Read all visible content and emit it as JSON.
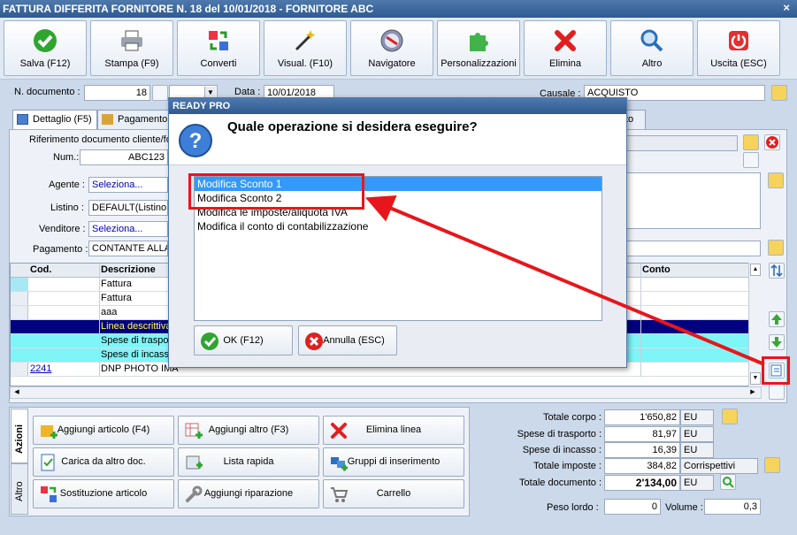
{
  "window": {
    "title": "FATTURA DIFFERITA FORNITORE N. 18 del 10/01/2018 - FORNITORE ABC",
    "close": "×"
  },
  "toolbar": [
    {
      "label": "Salva (F12)",
      "icon": "check-icon"
    },
    {
      "label": "Stampa (F9)",
      "icon": "printer-icon"
    },
    {
      "label": "Converti",
      "icon": "convert-icon"
    },
    {
      "label": "Visual. (F10)",
      "icon": "magic-wand-icon"
    },
    {
      "label": "Navigatore",
      "icon": "compass-icon"
    },
    {
      "label": "Personalizzazioni",
      "icon": "puzzle-icon"
    },
    {
      "label": "Elimina",
      "icon": "delete-icon"
    },
    {
      "label": "Altro",
      "icon": "magnifier-icon"
    },
    {
      "label": "Uscita (ESC)",
      "icon": "power-icon"
    }
  ],
  "header": {
    "ndoc_label": "N. documento :",
    "ndoc_value": "18",
    "data_label": "Data :",
    "data_value": "10/01/2018",
    "causale_label": "Causale :",
    "causale_value": "ACQUISTO"
  },
  "tabs": {
    "dettaglio": "Dettaglio (F5)",
    "pagamento": "Pagamento",
    "last": "to"
  },
  "form": {
    "riferimento_label": "Riferimento documento cliente/fo",
    "num_label": "Num.:",
    "num_value": "ABC123",
    "agente_label": "Agente :",
    "agente_value": "Seleziona...",
    "listino_label": "Listino :",
    "listino_value": "DEFAULT(Listino a",
    "venditore_label": "Venditore :",
    "venditore_value": "Seleziona...",
    "pagamento_label": "Pagamento :",
    "pagamento_value": "CONTANTE ALLA C"
  },
  "grid": {
    "col_cod": "Cod.",
    "col_descr": "Descrizione",
    "col_conto": "Conto",
    "rows": [
      {
        "cod": "",
        "descr": "Fattura",
        "style": "normal"
      },
      {
        "cod": "",
        "descr": "Fattura",
        "style": "normal"
      },
      {
        "cod": "",
        "descr": "aaa",
        "style": "normal"
      },
      {
        "cod": "",
        "descr": "Linea descrittiva",
        "style": "dark"
      },
      {
        "cod": "",
        "descr": "Spese di trasporto",
        "style": "cyan"
      },
      {
        "cod": "",
        "descr": "Spese di incasso",
        "style": "cyan"
      },
      {
        "cod": "2241",
        "descr": "DNP PHOTO IMA",
        "style": "link"
      }
    ]
  },
  "azioni": {
    "tab_azioni": "Azioni",
    "tab_altro": "Altro",
    "buttons": [
      {
        "label": "Aggiungi articolo (F4)",
        "icon": "add-article-icon"
      },
      {
        "label": "Aggiungi altro (F3)",
        "icon": "add-other-icon"
      },
      {
        "label": "Elimina linea",
        "icon": "delete-line-icon"
      },
      {
        "label": "Carica da altro doc.",
        "icon": "load-doc-icon"
      },
      {
        "label": "Lista rapida",
        "icon": "quick-list-icon"
      },
      {
        "label": "Gruppi di inserimento",
        "icon": "groups-icon"
      },
      {
        "label": "Sostituzione articolo",
        "icon": "replace-icon"
      },
      {
        "label": "Aggiungi riparazione",
        "icon": "wrench-icon"
      },
      {
        "label": "Carrello",
        "icon": "cart-icon"
      }
    ]
  },
  "totals": {
    "totale_corpo_label": "Totale corpo :",
    "totale_corpo": "1'650,82",
    "spese_trasporto_label": "Spese di trasporto :",
    "spese_trasporto": "81,97",
    "spese_incasso_label": "Spese di incasso :",
    "spese_incasso": "16,39",
    "totale_imposte_label": "Totale imposte :",
    "totale_imposte": "384,82",
    "totale_imposte_extra": "Corrispettivi",
    "totale_documento_label": "Totale documento :",
    "totale_documento": "2'134,00",
    "currency": "EU",
    "peso_label": "Peso lordo :",
    "peso_value": "0",
    "volume_label": "Volume :",
    "volume_value": "0,3"
  },
  "dialog": {
    "title": "READY PRO",
    "question": "Quale operazione si desidera eseguire?",
    "options": [
      "Modifica Sconto 1",
      "Modifica Sconto 2",
      "Modifica le imposte/aliquota IVA",
      "Modifica il conto di contabilizzazione"
    ],
    "ok_label": "OK (F12)",
    "cancel_label": "Annulla (ESC)"
  },
  "colors": {
    "title_bar": "#2f5a90",
    "selection": "#3399ff",
    "annotation": "#e8161b",
    "dark_row": "#000080",
    "cyan_row": "#7ff5f7"
  }
}
